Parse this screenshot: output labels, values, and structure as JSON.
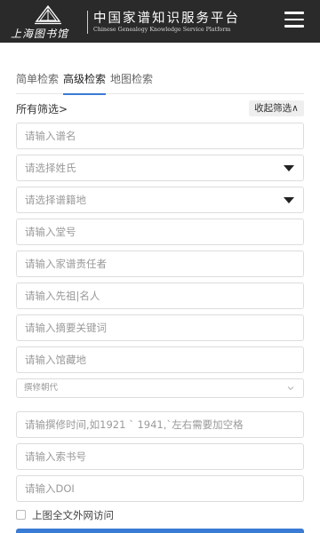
{
  "header": {
    "logo_text": "上海图书馆",
    "title": "中国家谱知识服务平台",
    "subtitle": "Chinese Genealogy Knowledge Service Platform",
    "menu_icon": "hamburger-menu-icon"
  },
  "tabs": [
    {
      "label": "简单检索",
      "active": false
    },
    {
      "label": "高级检索",
      "active": true
    },
    {
      "label": "地图检索",
      "active": false
    }
  ],
  "filters": {
    "all_filters_label": "所有筛选>",
    "collapse_label": "收起筛选∧"
  },
  "form": {
    "fields": [
      {
        "type": "text",
        "placeholder": "请输入谱名"
      },
      {
        "type": "select",
        "placeholder": "请选择姓氏"
      },
      {
        "type": "select",
        "placeholder": "请选择谱籍地"
      },
      {
        "type": "text",
        "placeholder": "请输入堂号"
      },
      {
        "type": "text",
        "placeholder": "请输入家谱责任者"
      },
      {
        "type": "text",
        "placeholder": "请输入先祖|名人"
      },
      {
        "type": "text",
        "placeholder": "请输入摘要关键词"
      },
      {
        "type": "text",
        "placeholder": "请输入馆藏地"
      },
      {
        "type": "select-small",
        "placeholder": "撰修朝代"
      },
      {
        "type": "text",
        "placeholder": "请输撰修时间,如1921 ` 1941,`左右需要加空格"
      },
      {
        "type": "text",
        "placeholder": "请输入索书号"
      },
      {
        "type": "text",
        "placeholder": "请输入DOI"
      }
    ],
    "checkbox_label": "上图全文外网访问",
    "checkbox_checked": false
  },
  "colors": {
    "header_bg": "#2a2a2a",
    "accent": "#3a7bd5"
  }
}
